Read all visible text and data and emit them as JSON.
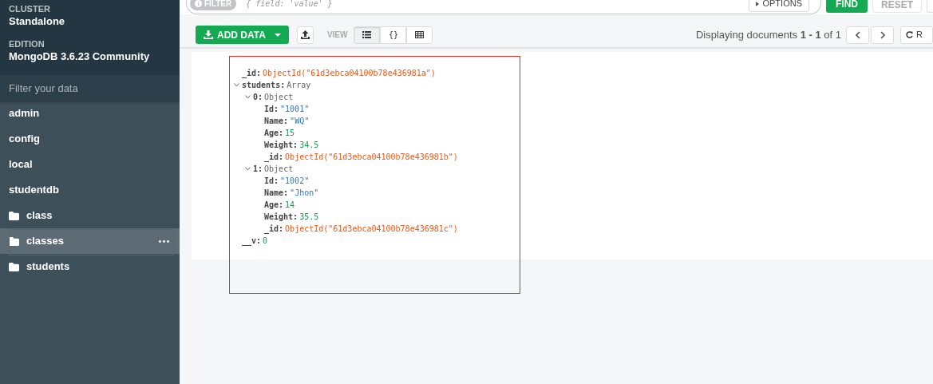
{
  "sidebar": {
    "cluster_label": "CLUSTER",
    "cluster": "Standalone",
    "edition_label": "EDITION",
    "edition": "MongoDB 3.6.23 Community",
    "filter_placeholder": "Filter your data",
    "items": [
      {
        "name": "admin",
        "kind": "database",
        "selected": false,
        "highlighted": false
      },
      {
        "name": "config",
        "kind": "database",
        "selected": false,
        "highlighted": false
      },
      {
        "name": "local",
        "kind": "database",
        "selected": false,
        "highlighted": false
      },
      {
        "name": "studentdb",
        "kind": "database",
        "selected": false,
        "highlighted": false
      },
      {
        "name": "class",
        "kind": "collection",
        "selected": false,
        "highlighted": false
      },
      {
        "name": "classes",
        "kind": "collection",
        "selected": true,
        "highlighted": true
      },
      {
        "name": "students",
        "kind": "collection",
        "selected": false,
        "highlighted": false
      }
    ]
  },
  "query_bar": {
    "filter_badge": "FILTER",
    "placeholder": "{ field: 'value' }",
    "options": "OPTIONS",
    "find": "FIND",
    "reset": "RESET"
  },
  "toolbar": {
    "add_data": "ADD DATA",
    "view_label": "VIEW",
    "views": [
      {
        "kind": "list",
        "selected": true
      },
      {
        "kind": "json",
        "label": "{}",
        "selected": false
      },
      {
        "kind": "table",
        "selected": false
      }
    ],
    "displaying": "Displaying documents **1 - 1** of 1",
    "refresh": "R"
  },
  "document": {
    "highlighted": true,
    "fields": [
      {
        "key": "_id:",
        "kind": "objectid",
        "value": "ObjectId(\"61d3ebca04100b78e436981a\")"
      },
      {
        "key": "students:",
        "kind": "array",
        "value": "Array",
        "expanded": true,
        "children": [
          {
            "key": "0:",
            "kind": "object",
            "value": "Object",
            "expanded": true,
            "children": [
              {
                "key": "Id:",
                "kind": "string",
                "value": "\"1001\""
              },
              {
                "key": "Name:",
                "kind": "string",
                "value": "\"WQ\""
              },
              {
                "key": "Age:",
                "kind": "number",
                "value": "15"
              },
              {
                "key": "Weight:",
                "kind": "number",
                "value": "34.5"
              },
              {
                "key": "_id:",
                "kind": "objectid",
                "value": "ObjectId(\"61d3ebca04100b78e436981b\")"
              }
            ]
          },
          {
            "key": "1:",
            "kind": "object",
            "value": "Object",
            "expanded": true,
            "children": [
              {
                "key": "Id:",
                "kind": "string",
                "value": "\"1002\""
              },
              {
                "key": "Name:",
                "kind": "string",
                "value": "\"Jhon\""
              },
              {
                "key": "Age:",
                "kind": "number",
                "value": "14"
              },
              {
                "key": "Weight:",
                "kind": "number",
                "value": "35.5"
              },
              {
                "key": "_id:",
                "kind": "objectid",
                "value": "ObjectId(\"61d3ebca04100b78e436981c\")"
              }
            ]
          }
        ]
      },
      {
        "key": "__v:",
        "kind": "number",
        "value": "0"
      }
    ]
  }
}
